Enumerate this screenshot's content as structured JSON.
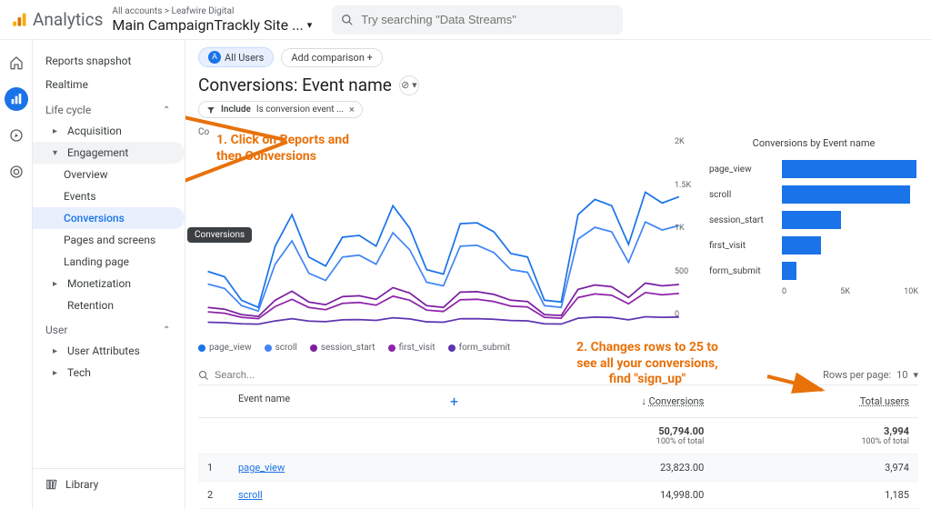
{
  "header": {
    "brand": "Analytics",
    "breadcrumb_top": "All accounts > Leafwire Digital",
    "property": "Main CampaignTrackly Site ...",
    "search_placeholder": "Try searching \"Data Streams\""
  },
  "sidebar": {
    "snapshot": "Reports snapshot",
    "realtime": "Realtime",
    "sections": {
      "lifecycle": "Life cycle",
      "user": "User"
    },
    "items": {
      "acquisition": "Acquisition",
      "engagement": "Engagement",
      "overview": "Overview",
      "events": "Events",
      "conversions": "Conversions",
      "pages": "Pages and screens",
      "landing": "Landing page",
      "monetization": "Monetization",
      "retention": "Retention",
      "user_attributes": "User Attributes",
      "tech": "Tech"
    },
    "library": "Library",
    "tooltip": "Conversions"
  },
  "report": {
    "segment_label": "All Users",
    "compare_label": "Add comparison +",
    "title": "Conversions: Event name",
    "filter_prefix": "Include",
    "filter_text": "Is conversion event ...",
    "co_label": "Co"
  },
  "chart_data": {
    "line": {
      "type": "line",
      "y_ticks": [
        "2K",
        "1.5K",
        "1K",
        "500",
        "0"
      ],
      "ylim": [
        0,
        2000
      ],
      "series": [
        {
          "name": "page_view",
          "color": "#1a73e8",
          "values": [
            620,
            560,
            300,
            220,
            900,
            1250,
            780,
            680,
            1000,
            1020,
            900,
            1350,
            1100,
            640,
            590,
            1150,
            1160,
            1060,
            820,
            780,
            300,
            280,
            1250,
            1420,
            1350,
            920,
            1500,
            1380,
            1450
          ]
        },
        {
          "name": "scroll",
          "color": "#4285f4",
          "values": [
            480,
            430,
            240,
            180,
            700,
            960,
            600,
            520,
            780,
            800,
            700,
            1050,
            860,
            500,
            460,
            900,
            910,
            830,
            640,
            610,
            240,
            220,
            980,
            1110,
            1060,
            720,
            1170,
            1080,
            1130
          ]
        },
        {
          "name": "session_start",
          "color": "#7b1fa2",
          "values": [
            220,
            200,
            140,
            120,
            300,
            400,
            280,
            250,
            340,
            350,
            310,
            440,
            380,
            240,
            220,
            390,
            395,
            365,
            300,
            285,
            140,
            130,
            420,
            470,
            450,
            330,
            490,
            460,
            475
          ]
        },
        {
          "name": "first_visit",
          "color": "#8e24aa",
          "values": [
            170,
            155,
            110,
            95,
            230,
            310,
            220,
            195,
            265,
            275,
            245,
            345,
            300,
            190,
            175,
            305,
            310,
            285,
            235,
            225,
            110,
            100,
            330,
            370,
            355,
            260,
            385,
            360,
            375
          ]
        },
        {
          "name": "form_submit",
          "color": "#5e35b1",
          "values": [
            55,
            50,
            38,
            34,
            70,
            95,
            68,
            62,
            82,
            85,
            76,
            105,
            92,
            60,
            56,
            94,
            95,
            88,
            74,
            71,
            38,
            35,
            100,
            112,
            108,
            82,
            116,
            110,
            113
          ]
        }
      ]
    },
    "bars": {
      "type": "bar",
      "title": "Conversions by Event name",
      "xticks": [
        "0",
        "5K",
        "10K"
      ],
      "xmax": 12000,
      "items": [
        {
          "name": "page_view",
          "value": 11800
        },
        {
          "name": "scroll",
          "value": 11300
        },
        {
          "name": "session_start",
          "value": 5200
        },
        {
          "name": "first_visit",
          "value": 3400
        },
        {
          "name": "form_submit",
          "value": 1300
        }
      ]
    }
  },
  "table": {
    "search_placeholder": "Search...",
    "rows_label": "Rows per page:",
    "rows_value": "10",
    "cols": {
      "event": "Event name",
      "conversions": "Conversions",
      "users": "Total users"
    },
    "totals": {
      "conversions": "50,794.00",
      "conv_pct": "100% of total",
      "users": "3,994",
      "users_pct": "100% of total"
    },
    "rows": [
      {
        "idx": "1",
        "name": "page_view",
        "conversions": "23,823.00",
        "users": "3,974"
      },
      {
        "idx": "2",
        "name": "scroll",
        "conversions": "14,998.00",
        "users": "1,185"
      }
    ]
  },
  "annotations": {
    "a1_l1": "1. Click on Reports and",
    "a1_l2": "then Conversions",
    "a2_l1": "2. Changes rows to 25 to",
    "a2_l2": "see all your conversions,",
    "a2_l3": "find \"sign_up\""
  }
}
